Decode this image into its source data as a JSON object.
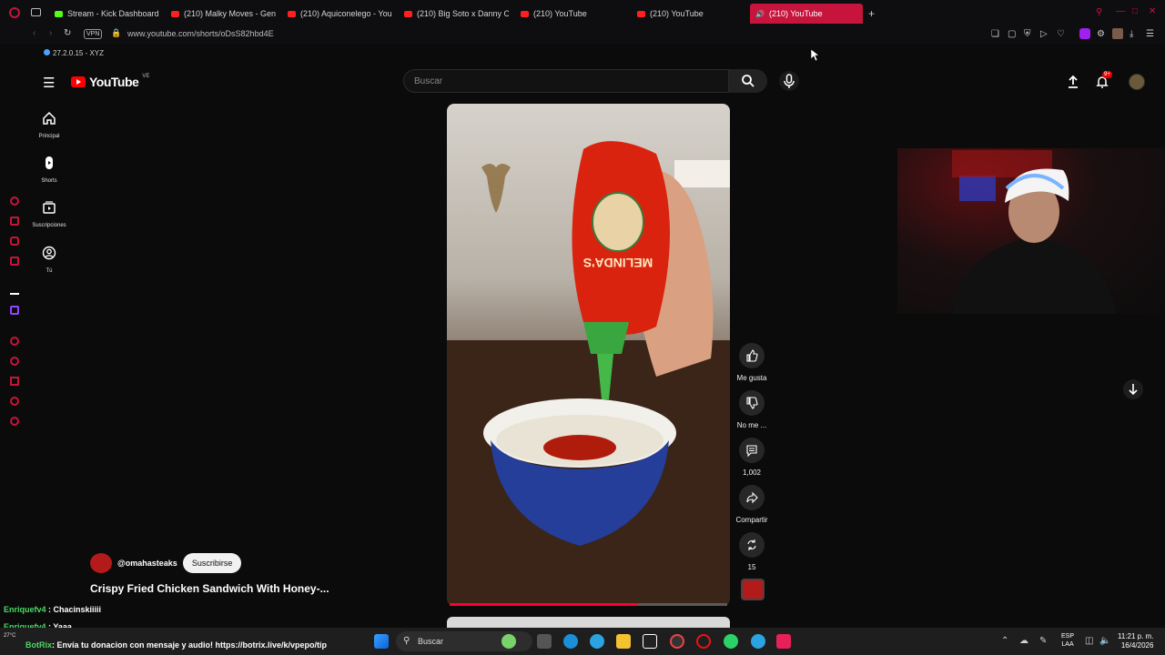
{
  "browser": {
    "tabs": [
      {
        "label": "Stream - Kick Dashboard",
        "active": false
      },
      {
        "label": "(210) Malky Moves - Gene",
        "active": false
      },
      {
        "label": "(210) Aquiconelego - You",
        "active": false
      },
      {
        "label": "(210) Big Soto x Danny O",
        "active": false
      },
      {
        "label": "(210) YouTube",
        "active": false
      },
      {
        "label": "(210) YouTube",
        "active": false
      },
      {
        "label": "(210) YouTube",
        "active": true
      }
    ],
    "url": "www.youtube.com/shorts/oDsS82hbd4E",
    "vpn_label": "VPN",
    "version": "27.2.0.15 - XYZ"
  },
  "youtube": {
    "logo_text": "YouTube",
    "country_code": "VE",
    "search_placeholder": "Buscar",
    "notification_count": "9+",
    "nav": [
      {
        "label": "Principal",
        "icon": "home-icon"
      },
      {
        "label": "Shorts",
        "icon": "shorts-icon"
      },
      {
        "label": "Suscripciones",
        "icon": "subscriptions-icon"
      },
      {
        "label": "Tú",
        "icon": "you-icon"
      }
    ],
    "short": {
      "channel": "@omahasteaks",
      "subscribe_label": "Suscribirse",
      "title": "Crispy Fried Chicken Sandwich With Honey-...",
      "progress": 0.68,
      "bottle_text": "MELINDA'S",
      "actions": [
        {
          "label": "Me gusta",
          "icon": "thumbs-up-icon"
        },
        {
          "label": "No me ...",
          "icon": "thumbs-down-icon"
        },
        {
          "label": "1,002",
          "icon": "comment-icon"
        },
        {
          "label": "Compartir",
          "icon": "share-icon"
        },
        {
          "label": "15",
          "icon": "remix-icon"
        }
      ]
    }
  },
  "chat": [
    {
      "user": "Enriquefv4",
      "message": " : Chacinskiiiii"
    },
    {
      "user": "Enriquefv4",
      "message": " : Yaaa"
    },
    {
      "user": "BotRix",
      "message": ": Envía tu donacion con mensaje y audio! https://botrix.live/k/vpepo/tip"
    }
  ],
  "taskbar": {
    "search_label": "Buscar",
    "weather": "27°C",
    "lang_line1": "ESP",
    "lang_line2": "LAA",
    "time": "11:21 p. m.",
    "date": "16/4/2026"
  },
  "colors": {
    "accent": "#c6143c",
    "youtube_red": "#ff0000",
    "chat_user": "#4cd964"
  }
}
